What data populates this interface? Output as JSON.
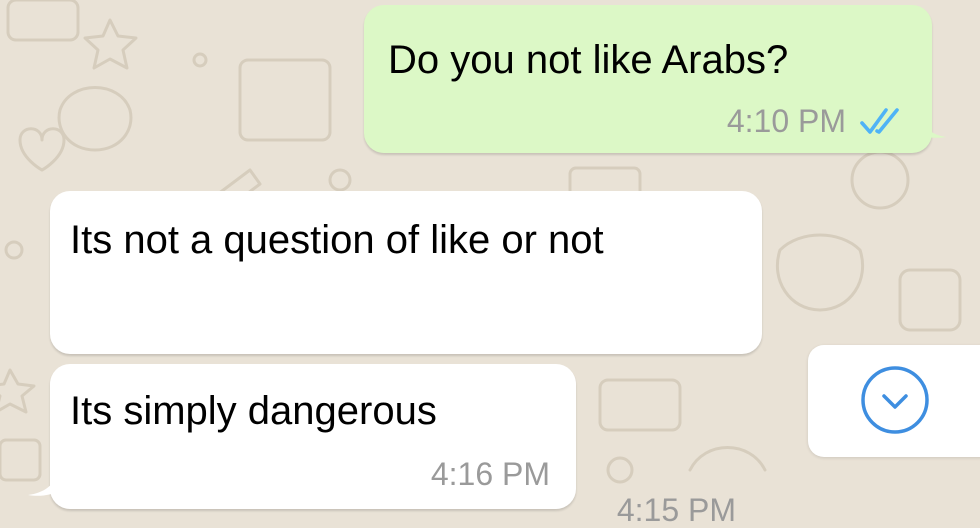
{
  "conversation": {
    "messages": [
      {
        "direction": "outgoing",
        "text": "Do you not like Arabs?",
        "time": "4:10 PM",
        "status_icon": "double-check-read-icon"
      },
      {
        "direction": "incoming",
        "text": "Its not a question of like or not",
        "time": "4:15 PM"
      },
      {
        "direction": "incoming",
        "text": "Its simply dangerous",
        "time": "4:16 PM"
      }
    ]
  },
  "controls": {
    "scroll_to_bottom_icon": "chevron-down-circle-icon"
  },
  "colors": {
    "wallpaper": "#e9e2d6",
    "outgoing_bubble": "#dcf8c6",
    "incoming_bubble": "#ffffff",
    "read_ticks": "#4fb3f6",
    "scroll_button_accent": "#3e8ee0"
  }
}
